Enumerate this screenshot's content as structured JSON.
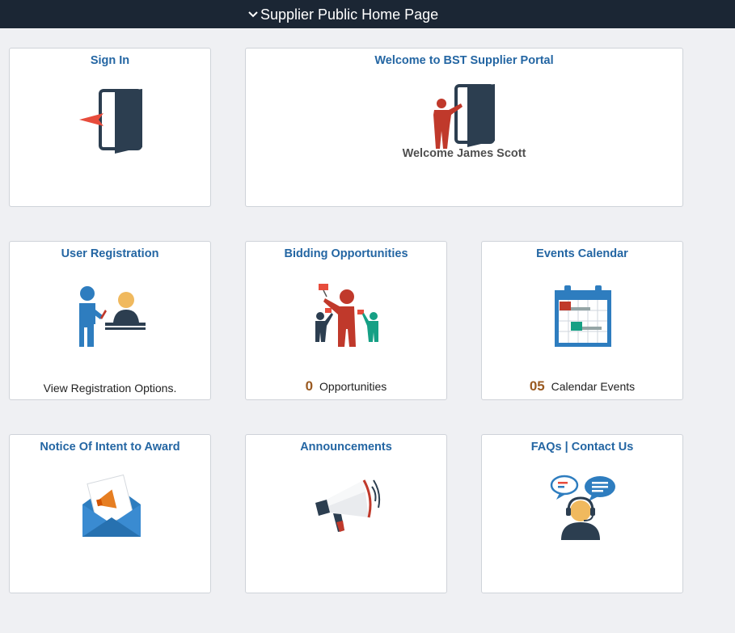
{
  "header": {
    "title": "Supplier Public Home Page"
  },
  "tiles": {
    "sign_in": {
      "title": "Sign In"
    },
    "welcome": {
      "title": "Welcome to BST Supplier Portal",
      "user": "Welcome James Scott"
    },
    "registration": {
      "title": "User Registration",
      "footer": "View Registration Options."
    },
    "bidding": {
      "title": "Bidding Opportunities",
      "count": "0",
      "footer": "Opportunities"
    },
    "events": {
      "title": "Events Calendar",
      "count": "05",
      "footer": "Calendar Events"
    },
    "notice": {
      "title": "Notice Of Intent to Award"
    },
    "announcements": {
      "title": "Announcements"
    },
    "faqs": {
      "title": "FAQs | Contact Us"
    }
  },
  "colors": {
    "header_bg": "#1b2634",
    "tile_title": "#2466a3",
    "count": "#9a5a21",
    "accent_red": "#c0392b",
    "accent_teal": "#16a085",
    "accent_blue": "#2e7dbf"
  },
  "icons": {
    "header": "chevron-down-icon",
    "sign_in": "door-enter-icon",
    "welcome": "person-door-icon",
    "registration": "registration-desk-icon",
    "bidding": "bidding-people-icon",
    "events": "calendar-icon",
    "notice": "envelope-megaphone-icon",
    "announcements": "megaphone-icon",
    "faqs": "support-agent-icon"
  }
}
